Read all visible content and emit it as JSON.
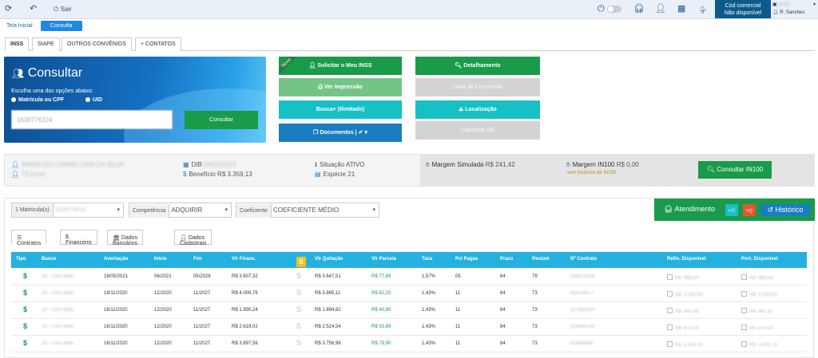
{
  "topbar": {
    "refresh_icon": "refresh-icon",
    "back_icon": "back-icon",
    "sair_label": "Sair",
    "cod_line1": "Cód comercial",
    "cod_line2": "Não disponível",
    "user_line1": "pWM",
    "user_line2": "R. Sanches",
    "badge_count": "0"
  },
  "nav": {
    "tela_inicial": "Tela Inicial",
    "consulta": "Consulta"
  },
  "tabs": [
    "INSS",
    "SIAPE",
    "OUTROS CONVÊNIOS",
    "+ CONTATOS"
  ],
  "hero": {
    "title": "Consultar",
    "subtitle": "Escolha uma das opções abaixo:",
    "radio1": "Matrícula ou CPF",
    "radio2": "UID",
    "input_value": "1630776224",
    "button": "Consultar"
  },
  "actions": {
    "novo": "Novo",
    "solicitar": "Solicitar o Meu INSS",
    "ver_impressao": "Ver Impressão",
    "busca": "Busca+ (Ilimitado)",
    "documentos": "Documentos |",
    "detalhamento": "Detalhamento",
    "carta": "Carta de Concessão",
    "localizacao": "Localização",
    "cadastrar": "Cadastrar NB"
  },
  "info": {
    "nome": "MARIA DO CARMO LIMA DA SILVA",
    "idade": "73 Anos",
    "dib_label": "DIB",
    "dib_value": "04/10/2013",
    "beneficio_label": "Benefício",
    "beneficio_value": "R$ 3.359,13",
    "situacao_label": "Situação",
    "situacao_value": "ATIVO",
    "especie_label": "Espécie",
    "especie_value": "21",
    "margem_sim_label": "Margem Simulada",
    "margem_sim_value": "R$ 241,42",
    "margem_in100_label": "Margem IN100",
    "margem_in100_value": "R$ 0,00",
    "sem_historico": "sem histórico de IN100",
    "consultar_in100": "Consultar IN100"
  },
  "filters": {
    "matricula_label": "1 Matrícula(s)",
    "matricula_value": "1630776224",
    "competencia_label": "Competência",
    "competencia_value": "ADQUIRIR",
    "coeficiente_label": "Coeficiente",
    "coeficiente_value": "COEFICIENTE MÉDIO"
  },
  "atendimento": {
    "label": "Atendimento",
    "historico": "Histórico"
  },
  "subtabs": [
    "Contratos",
    "Financeiro",
    "Dados Bancários",
    "Dados Cadastrais"
  ],
  "table": {
    "headers": [
      "Tipo",
      "Banco",
      "Averbação",
      "Início",
      "Fim",
      "Vlr Financ.",
      "",
      "Vlr Quitação",
      "Vlr Parcela",
      "Taxa",
      "Pcl Pagas",
      "Prazo",
      "Restam",
      "Nº Contrato",
      "Refin. Disponível",
      "Port. Disponível"
    ],
    "rows": [
      {
        "banco": "29 - ITAU BMG",
        "averbacao": "18/05/2021",
        "inicio": "06/2021",
        "fim": "05/2028",
        "financ": "R$ 3.607,32",
        "quitacao": "R$ 3.647,51",
        "parcela": "R$ 77,69",
        "taxa": "1,57%",
        "pagas": "05",
        "prazo": "84",
        "restam": "79",
        "contrato": "334612838",
        "refin": "R$ -968,54",
        "port": "R$ -968,54"
      },
      {
        "banco": "29 - ITAU BMG",
        "averbacao": "18/11/2020",
        "inicio": "12/2020",
        "fim": "11/2027",
        "financ": "R$ 4.009,76",
        "quitacao": "R$ 3.865,11",
        "parcela": "R$ 82,20",
        "taxa": "1,43%",
        "pagas": "11",
        "prazo": "84",
        "restam": "73",
        "contrato": "629764077",
        "refin": "R$ -1.030,63",
        "port": "R$ -1.030,63"
      },
      {
        "banco": "29 - ITAU BMG",
        "averbacao": "16/11/2020",
        "inicio": "12/2020",
        "fim": "11/2027",
        "financ": "R$ 1.990,24",
        "quitacao": "R$ 1.894,82",
        "parcela": "R$ 40,80",
        "taxa": "1,43%",
        "pagas": "11",
        "prazo": "84",
        "restam": "73",
        "contrato": "627965180",
        "refin": "R$ -487,92",
        "port": "R$ -487,92"
      },
      {
        "banco": "29 - ITAU BMG",
        "averbacao": "16/11/2020",
        "inicio": "12/2020",
        "fim": "11/2027",
        "financ": "R$ 2.619,02",
        "quitacao": "R$ 2.524,54",
        "parcela": "R$ 53,69",
        "taxa": "1,43%",
        "pagas": "11",
        "prazo": "84",
        "restam": "73",
        "contrato": "625965246",
        "refin": "R$ -673,16",
        "port": "R$ -673,16"
      },
      {
        "banco": "29 - ITAU BMG",
        "averbacao": "16/11/2020",
        "inicio": "12/2020",
        "fim": "11/2027",
        "financ": "R$ 3.897,56",
        "quitacao": "R$ 3.756,96",
        "parcela": "R$ 79,90",
        "taxa": "1,43%",
        "pagas": "11",
        "prazo": "84",
        "restam": "73",
        "contrato": "625964867",
        "refin": "R$ -1.001,79",
        "port": "R$ -1.001,79"
      }
    ]
  }
}
